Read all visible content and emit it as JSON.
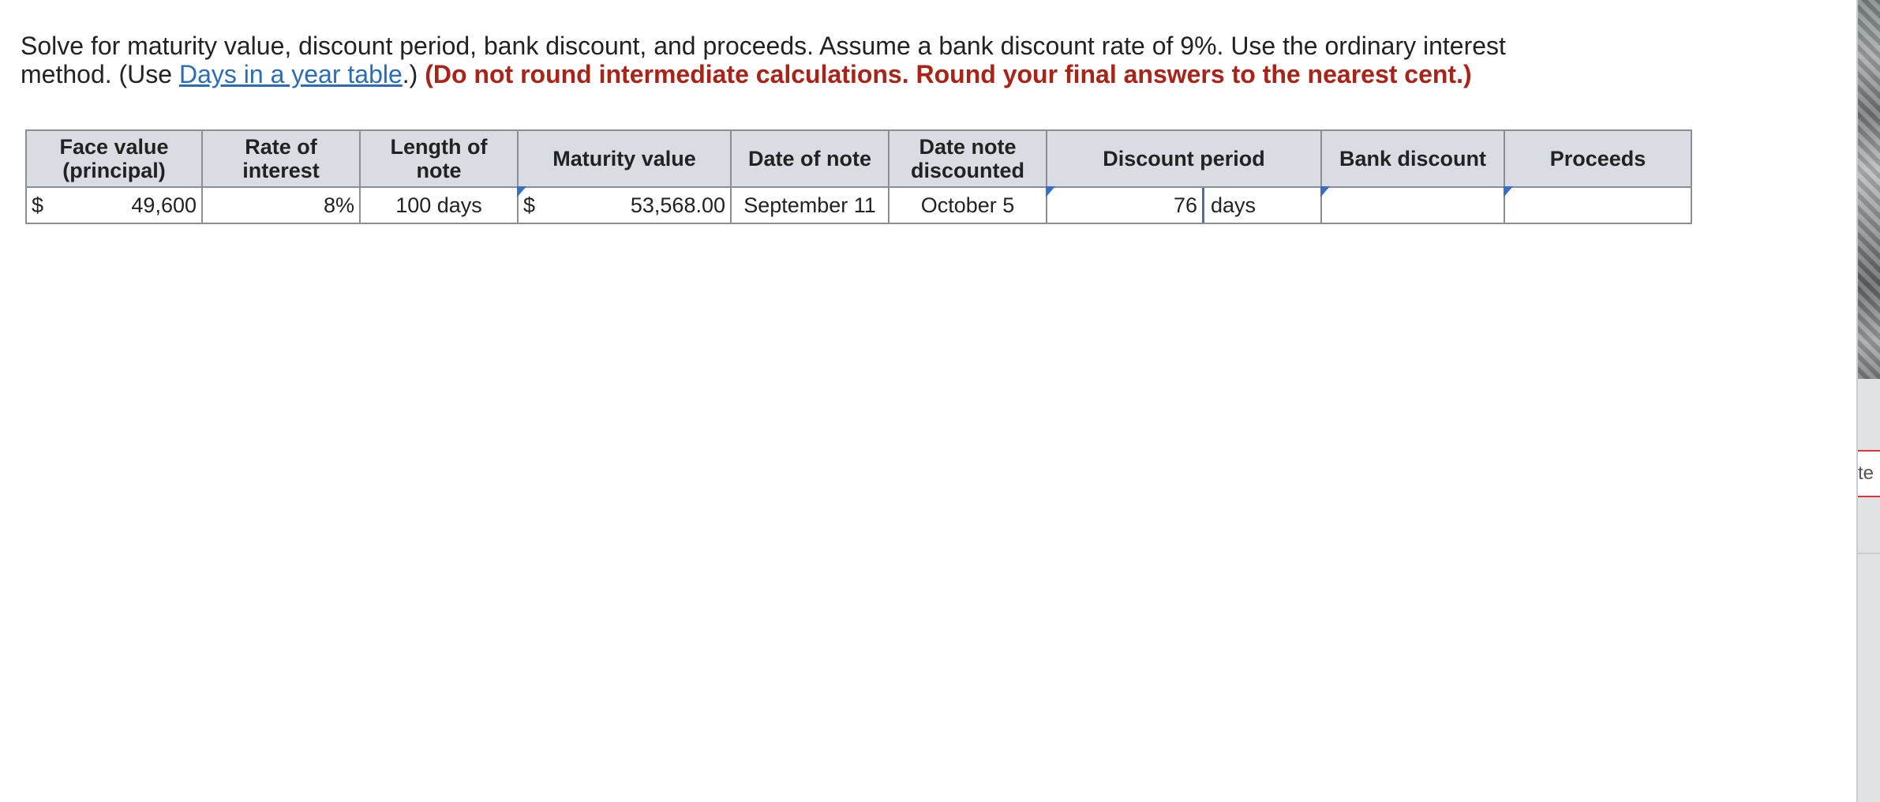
{
  "instructions": {
    "text_before_link": "Solve for maturity value, discount period, bank discount, and proceeds. Assume a bank discount rate of 9%. Use the ordinary interest method. (Use ",
    "link_text": "Days in a year table",
    "text_after_link": ".) ",
    "warning": "(Do not round intermediate calculations. Round your final answers to the nearest cent.)"
  },
  "table": {
    "headers": {
      "face_value": "Face value (principal)",
      "rate": "Rate of interest",
      "length": "Length of note",
      "maturity": "Maturity value",
      "date_of_note": "Date of note",
      "date_discounted": "Date note discounted",
      "discount_period": "Discount period",
      "bank_discount": "Bank discount",
      "proceeds": "Proceeds"
    },
    "row": {
      "face_currency": "$",
      "face_value": "49,600",
      "rate": "8%",
      "length": "100 days",
      "maturity_currency": "$",
      "maturity_value": "53,568.00",
      "date_of_note": "September 11",
      "date_discounted": "October 5",
      "discount_period_value": "76",
      "discount_period_unit": "days",
      "bank_discount_value": "",
      "proceeds_value": ""
    }
  },
  "sidebar": {
    "tab_text": "te"
  },
  "colors": {
    "link": "#2a6cb5",
    "warning": "#a82318",
    "header_bg": "#d9dde3",
    "input_border": "#4a6fa5"
  }
}
